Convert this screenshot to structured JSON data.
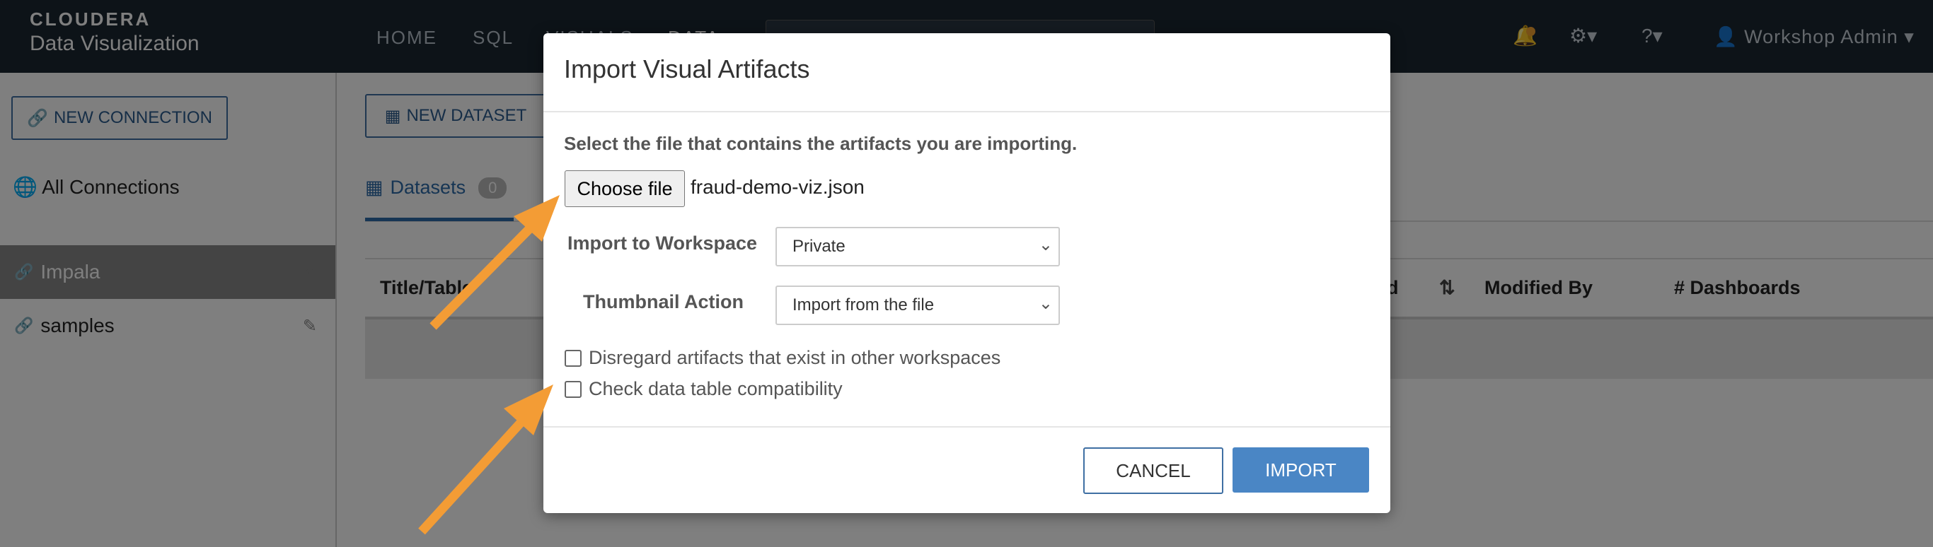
{
  "app": {
    "brand_logo": "CLOUDERA",
    "brand_subtitle": "Data Visualization"
  },
  "nav": {
    "items": [
      "HOME",
      "SQL",
      "VISUALS",
      "DATA"
    ]
  },
  "header_right": {
    "user": "Workshop Admin"
  },
  "left_panel": {
    "new_connection": "NEW CONNECTION",
    "all_connections": "All Connections",
    "connections": [
      {
        "label": "Impala",
        "selected": true
      },
      {
        "label": "samples",
        "selected": false
      }
    ]
  },
  "main": {
    "new_dataset": "NEW DATASET",
    "tab_label": "Datasets",
    "tab_count": "0",
    "columns": {
      "title": "Title/Table",
      "modified": "d",
      "modified_by": "Modified By",
      "dashboards": "# Dashboards"
    }
  },
  "modal": {
    "title": "Import Visual Artifacts",
    "prompt": "Select the file that contains the artifacts you are importing.",
    "choose_file": "Choose file",
    "file_name": "fraud-demo-viz.json",
    "workspace_label": "Import to Workspace",
    "workspace_value": "Private",
    "thumbnail_label": "Thumbnail Action",
    "thumbnail_value": "Import from the file",
    "checkbox_disregard": "Disregard artifacts that exist in other workspaces",
    "checkbox_compat": "Check data table compatibility",
    "cancel": "CANCEL",
    "import": "IMPORT"
  },
  "colors": {
    "topbar": "#1b2631",
    "accent": "#4a86c5",
    "arrow": "#f39c35"
  }
}
